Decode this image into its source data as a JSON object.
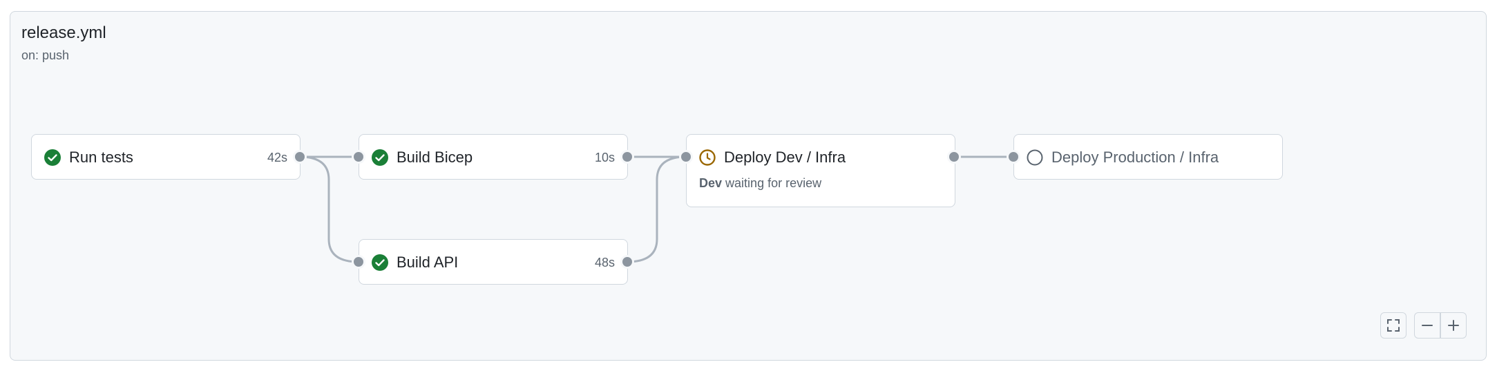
{
  "workflow": {
    "title": "release.yml",
    "trigger": "on: push"
  },
  "jobs": [
    {
      "name": "Run tests",
      "duration": "42s",
      "status": "success",
      "status_icon": "check-circle-icon"
    },
    {
      "name": "Build Bicep",
      "duration": "10s",
      "status": "success",
      "status_icon": "check-circle-icon"
    },
    {
      "name": "Build API",
      "duration": "48s",
      "status": "success",
      "status_icon": "check-circle-icon"
    },
    {
      "name": "Deploy Dev / Infra",
      "duration": "",
      "status": "waiting",
      "status_icon": "clock-icon",
      "environment": "Dev",
      "waiting_text": "waiting for review"
    },
    {
      "name": "Deploy Production / Infra",
      "duration": "",
      "status": "pending",
      "status_icon": "pending-circle-icon"
    }
  ],
  "controls": {
    "fullscreen_icon": "fullscreen-icon",
    "zoom_out_icon": "minus-icon",
    "zoom_in_icon": "plus-icon"
  },
  "colors": {
    "success": "#1a7f37",
    "waiting": "#9a6700",
    "pending": "#59636e",
    "edge": "#aab3bd",
    "port": "#8c959f"
  }
}
